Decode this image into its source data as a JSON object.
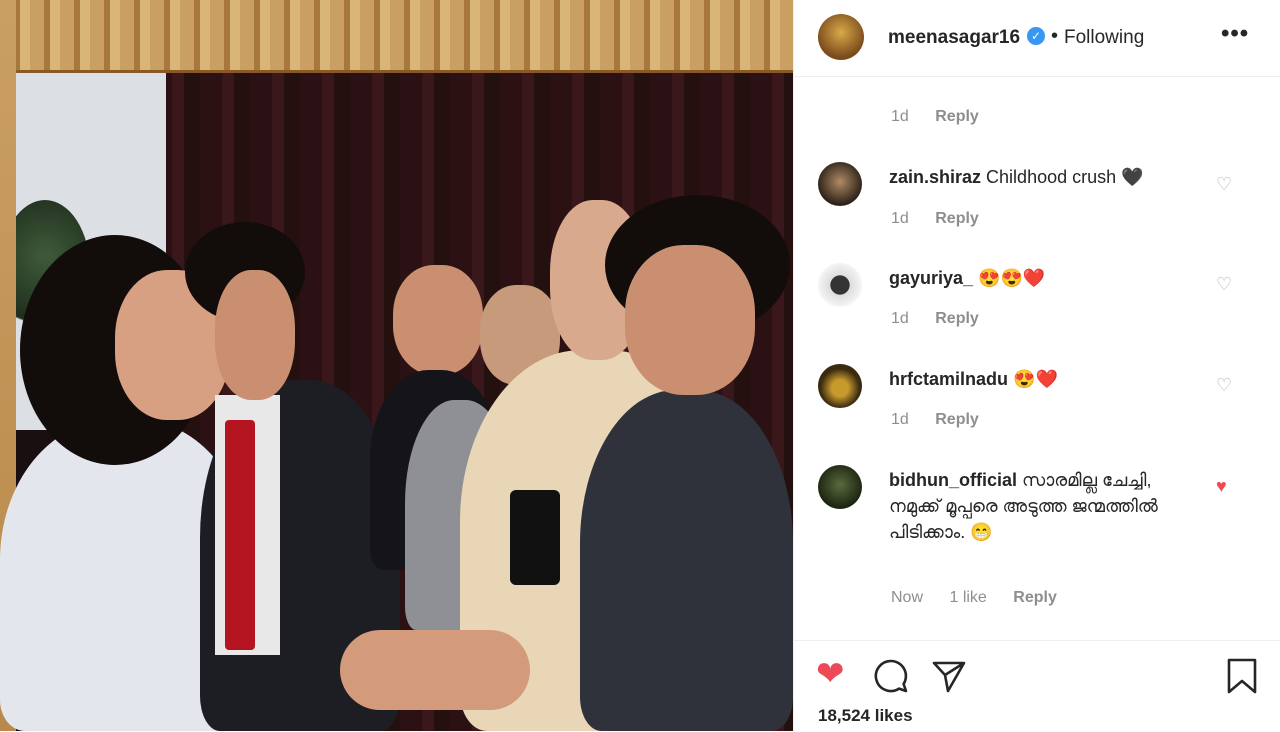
{
  "post": {
    "username": "meenasagar16",
    "verified_badge": "✓",
    "separator": "•",
    "follow_status": "Following",
    "more_icon": "•••",
    "likes": "18,524 likes"
  },
  "first_meta": {
    "time": "1d",
    "reply": "Reply"
  },
  "comments": [
    {
      "user": "zain.shiraz",
      "text": "Childhood crush 🖤",
      "time": "1d",
      "likes": "",
      "reply": "Reply",
      "liked": false
    },
    {
      "user": "gayuriya_",
      "text": "😍😍❤️",
      "time": "1d",
      "likes": "",
      "reply": "Reply",
      "liked": false
    },
    {
      "user": "hrfctamilnadu",
      "text": "😍❤️",
      "time": "1d",
      "likes": "",
      "reply": "Reply",
      "liked": false
    },
    {
      "user": "bidhun_official",
      "text": "സാരമില്ല ചേച്ചി, നമുക്ക് മൂപ്പരെ അടുത്ത ജന്മത്തിൽ പിടിക്കാം. 😁",
      "time": "Now",
      "likes": "1 like",
      "reply": "Reply",
      "liked": true
    }
  ],
  "icons": {
    "heart": "♡",
    "heart_filled": "♥",
    "like_big": "❤",
    "comment": "◯",
    "share": "➢",
    "save": "🔖"
  },
  "colors": {
    "like_red": "#ed4956",
    "verified_blue": "#3897f0",
    "muted": "#8e8e8e"
  }
}
